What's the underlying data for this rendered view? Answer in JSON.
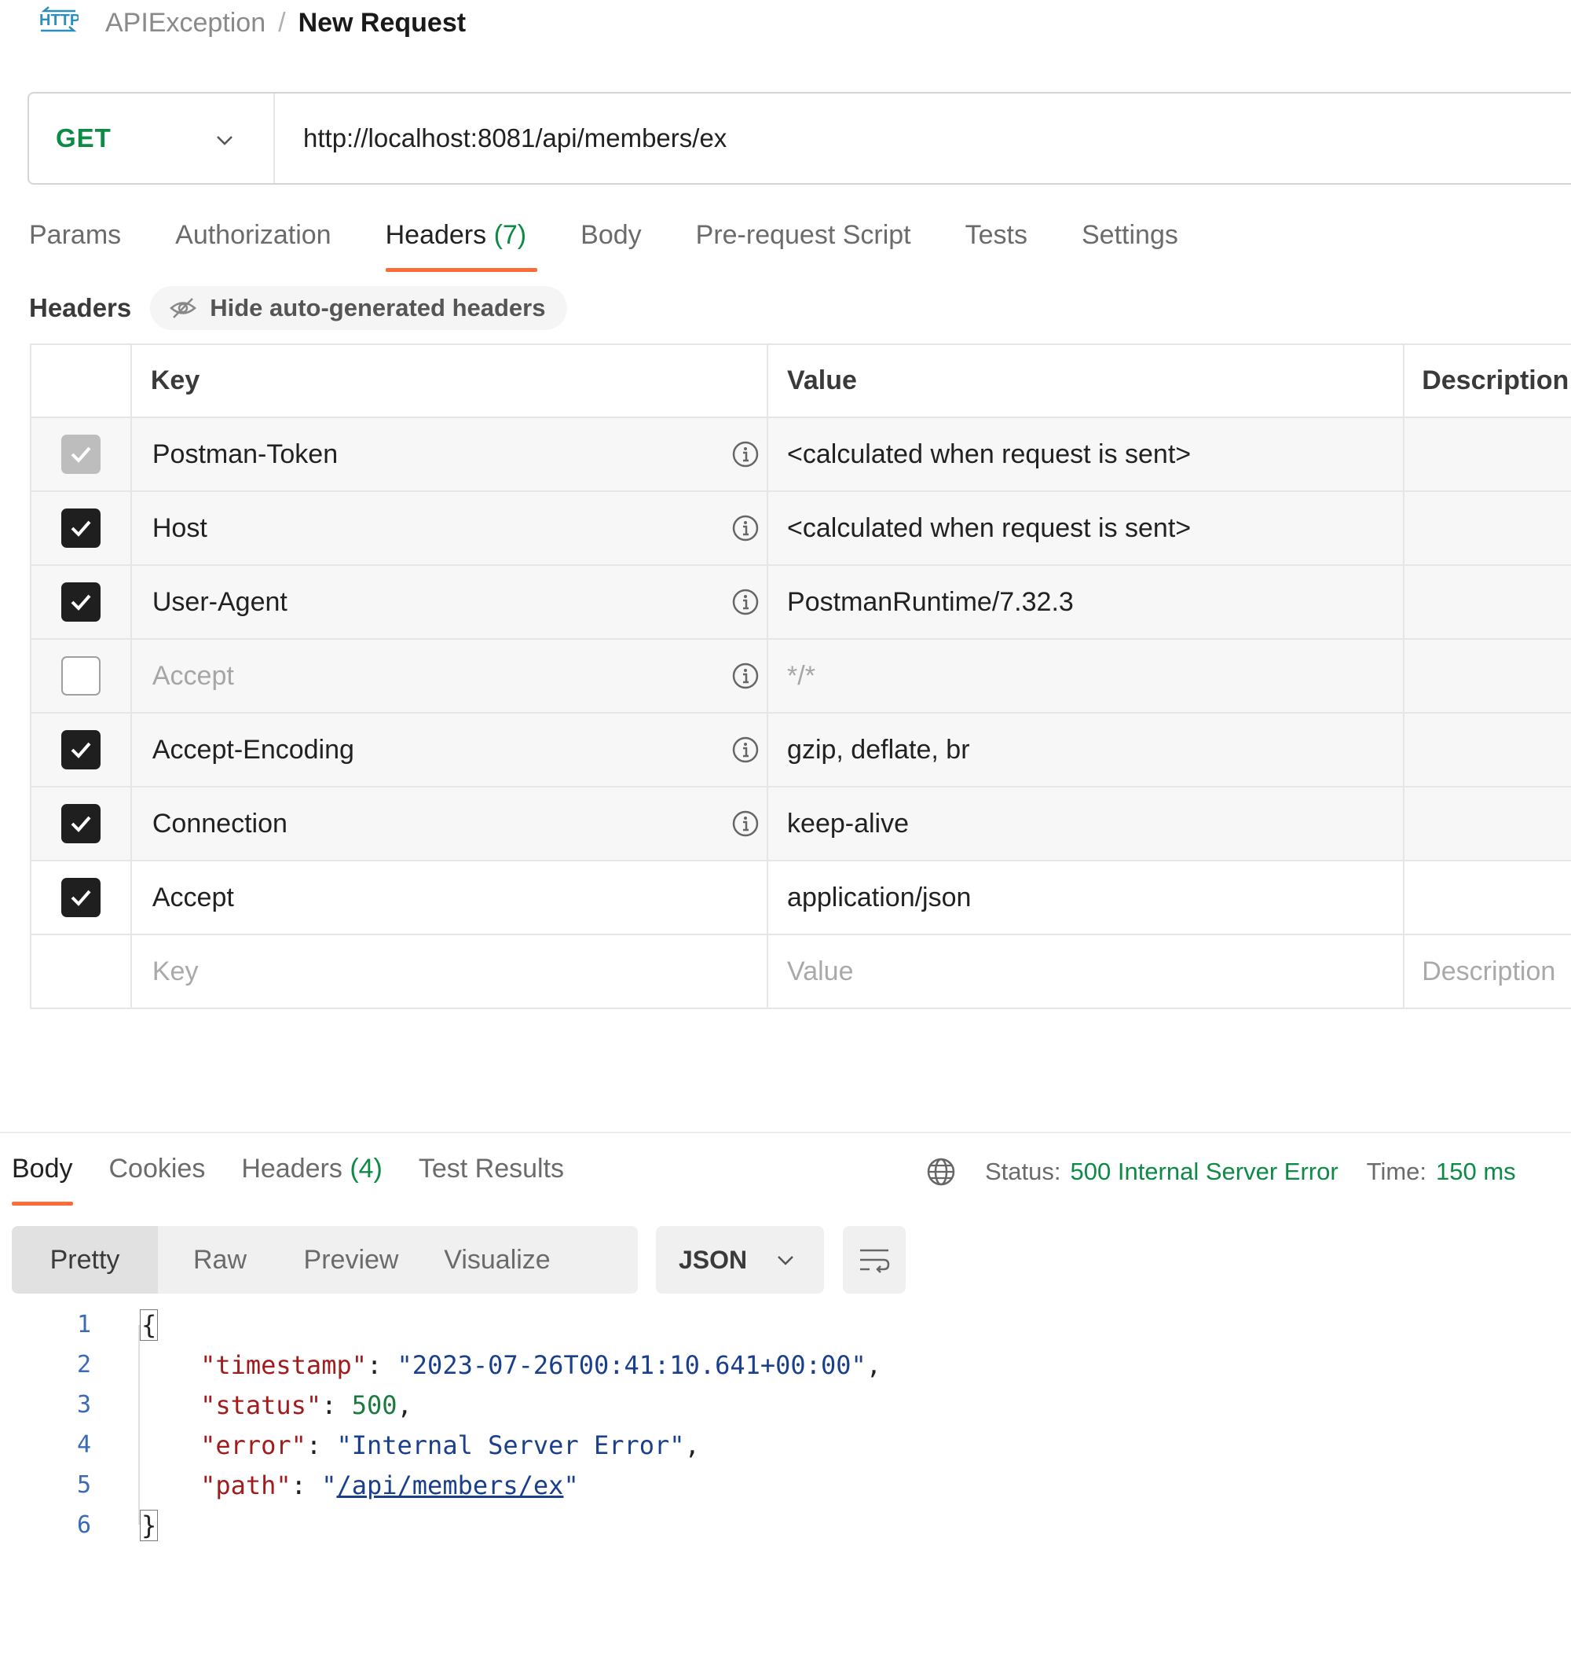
{
  "breadcrumb": {
    "icon": "http-icon",
    "parent": "APIException",
    "separator": "/",
    "current": "New Request"
  },
  "request": {
    "method": "GET",
    "url": "http://localhost:8081/api/members/ex"
  },
  "request_tabs": [
    {
      "label": "Params"
    },
    {
      "label": "Authorization"
    },
    {
      "label": "Headers",
      "count": "(7)",
      "active": true
    },
    {
      "label": "Body"
    },
    {
      "label": "Pre-request Script"
    },
    {
      "label": "Tests"
    },
    {
      "label": "Settings"
    }
  ],
  "headers_section": {
    "label": "Headers",
    "toggle_label": "Hide auto-generated headers"
  },
  "headers_table": {
    "columns": [
      "Key",
      "Value",
      "Description"
    ],
    "rows": [
      {
        "key": "Postman-Token",
        "value": "<calculated when request is sent>",
        "checked": "locked"
      },
      {
        "key": "Host",
        "value": "<calculated when request is sent>",
        "checked": "on"
      },
      {
        "key": "User-Agent",
        "value": "PostmanRuntime/7.32.3",
        "checked": "on"
      },
      {
        "key": "Accept",
        "value": "*/*",
        "checked": "off"
      },
      {
        "key": "Accept-Encoding",
        "value": "gzip, deflate, br",
        "checked": "on"
      },
      {
        "key": "Connection",
        "value": "keep-alive",
        "checked": "on"
      },
      {
        "key": "Accept",
        "value": "application/json",
        "checked": "on"
      }
    ],
    "new_row_placeholders": {
      "key": "Key",
      "value": "Value",
      "description": "Description"
    }
  },
  "response_tabs": [
    {
      "label": "Body",
      "active": true
    },
    {
      "label": "Cookies"
    },
    {
      "label": "Headers",
      "count": "(4)"
    },
    {
      "label": "Test Results"
    }
  ],
  "response_status": {
    "status_label": "Status:",
    "status_value": "500 Internal Server Error",
    "time_label": "Time:",
    "time_value": "150 ms"
  },
  "view_modes": [
    "Pretty",
    "Raw",
    "Preview",
    "Visualize"
  ],
  "format": "JSON",
  "response_body": {
    "line_numbers": [
      "1",
      "2",
      "3",
      "4",
      "5",
      "6"
    ],
    "open_brace": "{",
    "close_brace": "}",
    "timestamp_key": "\"timestamp\"",
    "timestamp_value": "\"2023-07-26T00:41:10.641+00:00\"",
    "status_key": "\"status\"",
    "status_value": "500",
    "error_key": "\"error\"",
    "error_value": "\"Internal Server Error\"",
    "path_key": "\"path\"",
    "path_value": "/api/members/ex"
  },
  "colors": {
    "accent": "#ff6c37",
    "method_get": "#0d8a45",
    "status_ok_text": "#0d8a45"
  }
}
